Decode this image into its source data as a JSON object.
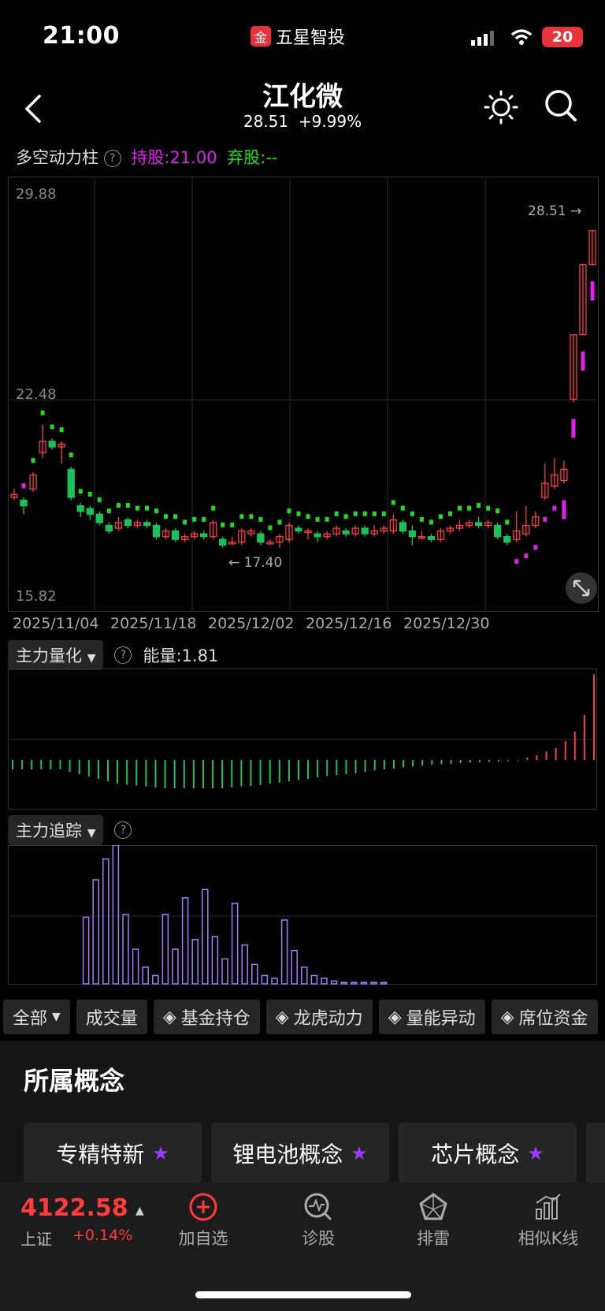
{
  "status": {
    "time": "21:00",
    "app_name": "五星智投",
    "app_logo_glyph": "金",
    "battery": "20"
  },
  "header": {
    "title": "江化微",
    "price": "28.51",
    "change": "+9.99%"
  },
  "main_chart": {
    "indicator_name": "多空动力柱",
    "hold_label": "持股:21.00",
    "abandon_label": "弃股:--",
    "y_ticks": [
      "29.88",
      "22.48",
      "15.82"
    ],
    "x_ticks": [
      "2025/11/04",
      "2025/11/18",
      "2025/12/02",
      "2025/12/16",
      "2025/12/30"
    ],
    "current_price_marker": "28.51 →",
    "low_marker": "← 17.40",
    "colors": {
      "up": "#ff3b3b",
      "down": "#19c35a",
      "hold": "#e61cf0",
      "abandon": "#19e019"
    }
  },
  "sub1": {
    "selector": "主力量化",
    "energy_label": "能量:1.81"
  },
  "sub2": {
    "selector": "主力追踪"
  },
  "tabs": [
    {
      "label": "全部",
      "icon": "dropdown-icon"
    },
    {
      "label": "成交量"
    },
    {
      "label": "基金持仓",
      "icon": "diamond-icon"
    },
    {
      "label": "龙虎动力",
      "icon": "diamond-icon"
    },
    {
      "label": "量能异动",
      "icon": "diamond-icon"
    },
    {
      "label": "席位资金",
      "icon": "diamond-icon"
    }
  ],
  "concept": {
    "title": "所属概念",
    "items": [
      "专精特新",
      "锂电池概念",
      "芯片概念"
    ]
  },
  "bottom": {
    "index_value": "4122.58",
    "index_name": "上证",
    "index_change": "+0.14%",
    "nav": [
      {
        "label": "加自选"
      },
      {
        "label": "诊股"
      },
      {
        "label": "排雷"
      },
      {
        "label": "相似K线"
      }
    ]
  },
  "chart_data": [
    {
      "type": "candlestick",
      "title": "江化微",
      "ylim": [
        15.82,
        29.88
      ],
      "x_ticks": [
        "2025/11/04",
        "2025/11/18",
        "2025/12/02",
        "2025/12/16",
        "2025/12/30"
      ],
      "candles": [
        [
          19.0,
          19.1,
          19.3,
          18.9
        ],
        [
          18.9,
          18.7,
          19.0,
          18.4
        ],
        [
          19.3,
          19.8,
          19.9,
          19.2
        ],
        [
          20.6,
          21.0,
          21.6,
          20.4
        ],
        [
          21.0,
          20.8,
          21.1,
          20.7
        ],
        [
          20.8,
          20.9,
          21.0,
          20.2
        ],
        [
          20.0,
          19.0,
          20.1,
          18.9
        ],
        [
          18.7,
          18.5,
          18.8,
          18.3
        ],
        [
          18.6,
          18.4,
          18.7,
          18.2
        ],
        [
          18.4,
          18.1,
          18.5,
          18.0
        ],
        [
          18.0,
          17.8,
          18.1,
          17.7
        ],
        [
          17.9,
          18.1,
          18.3,
          17.8
        ],
        [
          18.2,
          18.0,
          18.3,
          17.9
        ],
        [
          18.0,
          18.1,
          18.2,
          17.9
        ],
        [
          18.1,
          18.0,
          18.2,
          17.9
        ],
        [
          18.0,
          17.6,
          18.1,
          17.5
        ],
        [
          17.6,
          17.8,
          17.9,
          17.5
        ],
        [
          17.8,
          17.5,
          17.9,
          17.4
        ],
        [
          17.5,
          17.6,
          17.7,
          17.4
        ],
        [
          17.6,
          17.7,
          17.8,
          17.5
        ],
        [
          17.7,
          17.6,
          17.8,
          17.5
        ],
        [
          17.6,
          18.1,
          18.2,
          17.5
        ],
        [
          17.5,
          17.3,
          17.6,
          17.2
        ],
        [
          17.4,
          17.4,
          17.6,
          17.3
        ],
        [
          17.4,
          17.8,
          17.9,
          17.3
        ],
        [
          17.7,
          17.8,
          17.9,
          17.6
        ],
        [
          17.7,
          17.4,
          17.8,
          17.3
        ],
        [
          17.4,
          17.4,
          17.5,
          17.3
        ],
        [
          17.4,
          17.6,
          17.7,
          17.2
        ],
        [
          17.5,
          18.0,
          18.1,
          17.4
        ],
        [
          17.9,
          17.8,
          18.0,
          17.7
        ],
        [
          17.8,
          17.8,
          17.9,
          17.5
        ],
        [
          17.7,
          17.6,
          17.8,
          17.4
        ],
        [
          17.6,
          17.7,
          17.8,
          17.5
        ],
        [
          17.7,
          17.9,
          18.0,
          17.6
        ],
        [
          17.8,
          17.7,
          17.9,
          17.6
        ],
        [
          17.7,
          17.9,
          18.0,
          17.6
        ],
        [
          17.9,
          17.7,
          18.0,
          17.6
        ],
        [
          17.7,
          17.8,
          18.0,
          17.6
        ],
        [
          17.8,
          17.9,
          18.0,
          17.7
        ],
        [
          17.8,
          18.2,
          18.4,
          17.7
        ],
        [
          18.1,
          17.8,
          18.2,
          17.7
        ],
        [
          17.8,
          17.6,
          18.0,
          17.3
        ],
        [
          17.6,
          17.6,
          17.8,
          17.5
        ],
        [
          17.6,
          17.5,
          17.7,
          17.4
        ],
        [
          17.5,
          17.8,
          17.9,
          17.4
        ],
        [
          17.8,
          17.9,
          18.0,
          17.7
        ],
        [
          17.9,
          18.0,
          18.2,
          17.8
        ],
        [
          18.0,
          18.1,
          18.2,
          17.9
        ],
        [
          18.1,
          18.0,
          18.3,
          17.9
        ],
        [
          18.0,
          18.1,
          18.2,
          17.9
        ],
        [
          18.0,
          17.6,
          18.1,
          17.5
        ],
        [
          17.6,
          17.4,
          17.7,
          17.3
        ],
        [
          17.5,
          17.8,
          18.5,
          17.4
        ],
        [
          17.7,
          18.0,
          18.7,
          17.6
        ],
        [
          18.0,
          18.3,
          18.5,
          17.9
        ],
        [
          19.0,
          19.5,
          20.2,
          18.9
        ],
        [
          19.4,
          19.8,
          20.4,
          19.3
        ],
        [
          19.6,
          20.0,
          20.3,
          19.5
        ],
        [
          22.5,
          24.8,
          24.8,
          22.4
        ],
        [
          24.8,
          27.3,
          27.3,
          24.8
        ],
        [
          27.3,
          28.51,
          28.51,
          27.3
        ]
      ],
      "hold_line_present": true
    },
    {
      "type": "bar",
      "title": "主力量化",
      "energy": 1.81,
      "values": [
        -0.2,
        -0.2,
        -0.2,
        -0.2,
        -0.2,
        -0.2,
        -0.25,
        -0.3,
        -0.35,
        -0.4,
        -0.45,
        -0.5,
        -0.52,
        -0.54,
        -0.56,
        -0.58,
        -0.6,
        -0.6,
        -0.6,
        -0.6,
        -0.6,
        -0.6,
        -0.6,
        -0.58,
        -0.56,
        -0.55,
        -0.53,
        -0.5,
        -0.48,
        -0.45,
        -0.42,
        -0.4,
        -0.37,
        -0.34,
        -0.32,
        -0.3,
        -0.28,
        -0.25,
        -0.22,
        -0.2,
        -0.18,
        -0.16,
        -0.14,
        -0.12,
        -0.1,
        -0.09,
        -0.08,
        -0.07,
        -0.06,
        -0.05,
        -0.04,
        -0.03,
        -0.02,
        -0.01,
        0.05,
        0.1,
        0.18,
        0.25,
        0.4,
        0.6,
        0.95,
        1.81
      ],
      "colors": {
        "negative": "#19c35a",
        "positive": "#ff3b3b"
      }
    },
    {
      "type": "bar",
      "title": "主力追踪",
      "values": [
        0,
        0,
        0,
        0,
        0,
        0,
        0.48,
        0.75,
        0.9,
        1.0,
        0.5,
        0.25,
        0.12,
        0.06,
        0.5,
        0.25,
        0.62,
        0.32,
        0.68,
        0.34,
        0.18,
        0.58,
        0.28,
        0.14,
        0.06,
        0.04,
        0.46,
        0.24,
        0.12,
        0.06,
        0.04,
        0.02,
        0.01,
        0.01,
        0.01,
        0.01,
        0.01
      ],
      "colors": {
        "bar": "#a47cff"
      }
    }
  ]
}
